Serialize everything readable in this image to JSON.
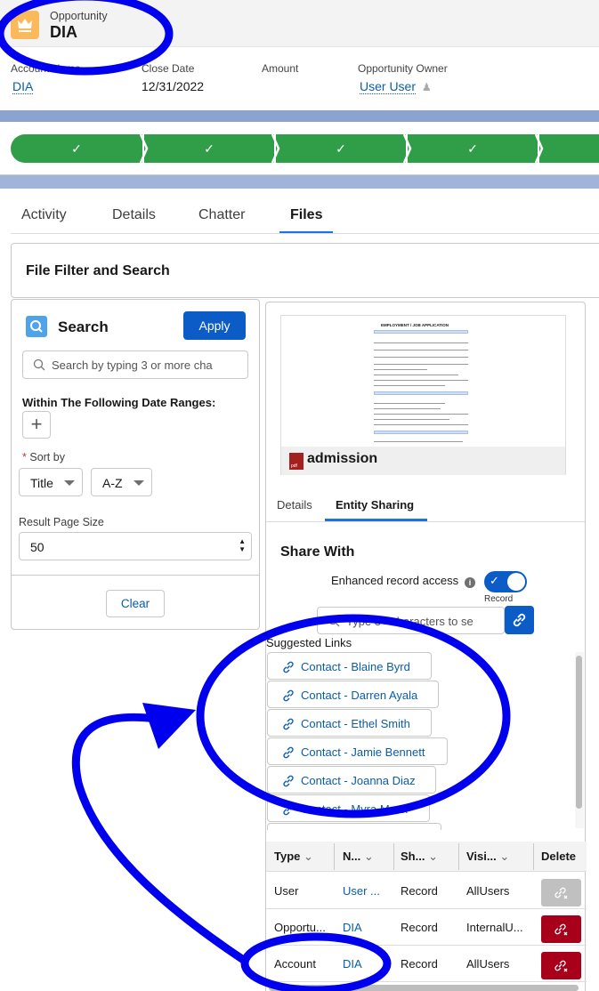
{
  "header": {
    "object_type": "Opportunity",
    "title": "DIA",
    "icon": "crown-icon",
    "icon_color": "#fcb95b",
    "fields": [
      {
        "label": "Account Name",
        "value": "DIA",
        "is_link": true
      },
      {
        "label": "Close Date",
        "value": "12/31/2022",
        "is_link": false
      },
      {
        "label": "Amount",
        "value": "",
        "is_link": false
      },
      {
        "label": "Opportunity Owner",
        "value": "User User",
        "is_link": true
      }
    ]
  },
  "path": {
    "steps": [
      {
        "state": "complete",
        "glyph": "✓"
      },
      {
        "state": "complete",
        "glyph": "✓"
      },
      {
        "state": "complete",
        "glyph": "✓"
      },
      {
        "state": "complete",
        "glyph": "✓"
      },
      {
        "state": "complete",
        "glyph": ""
      }
    ],
    "complete_color": "#309e48"
  },
  "tabs": [
    {
      "label": "Activity",
      "active": false
    },
    {
      "label": "Details",
      "active": false
    },
    {
      "label": "Chatter",
      "active": false
    },
    {
      "label": "Files",
      "active": true
    }
  ],
  "file_filter": {
    "title": "File Filter and Search",
    "search_title": "Search",
    "apply_label": "Apply",
    "search_placeholder": "Search by typing 3 or more cha",
    "date_ranges_label": "Within The Following Date Ranges:",
    "add_label": "+",
    "sort_by_label": "Sort by",
    "sort_required": "*",
    "sort_field": "Title",
    "sort_order": "A-Z",
    "page_size_label": "Result Page Size",
    "page_size": "50",
    "clear_label": "Clear"
  },
  "file": {
    "name": "admission",
    "type_icon": "pdf-icon",
    "preview_title": "EMPLOYMENT / JOB APPLICATION"
  },
  "file_tabs": [
    {
      "label": "Details",
      "active": false
    },
    {
      "label": "Entity Sharing",
      "active": true
    }
  ],
  "sharing": {
    "title": "Share With",
    "enhanced_label": "Enhanced record access",
    "toggle_on": true,
    "toggle_caption": "Record",
    "search_placeholder": "Type 3+ characters to se",
    "suggested_label": "Suggested Links",
    "suggested": [
      "Contact - Blaine Byrd",
      "Contact - Darren Ayala",
      "Contact - Ethel Smith",
      "Contact - Jamie Bennett",
      "Contact - Joanna Diaz",
      "Contact - Myra Mack",
      ""
    ]
  },
  "share_table": {
    "columns": [
      "Type",
      "N...",
      "Sh...",
      "Visi...",
      "Delete"
    ],
    "rows": [
      {
        "type": "User",
        "name": "User ...",
        "share": "Record",
        "visibility": "AllUsers",
        "delete_enabled": false
      },
      {
        "type": "Opportu...",
        "name": "DIA",
        "share": "Record",
        "visibility": "InternalU...",
        "delete_enabled": true
      },
      {
        "type": "Account",
        "name": "DIA",
        "share": "Record",
        "visibility": "AllUsers",
        "delete_enabled": true
      }
    ],
    "delete_color": "#a8001b",
    "delete_disabled_color": "#c0c0c0"
  },
  "annotation_color": "#0000ee"
}
